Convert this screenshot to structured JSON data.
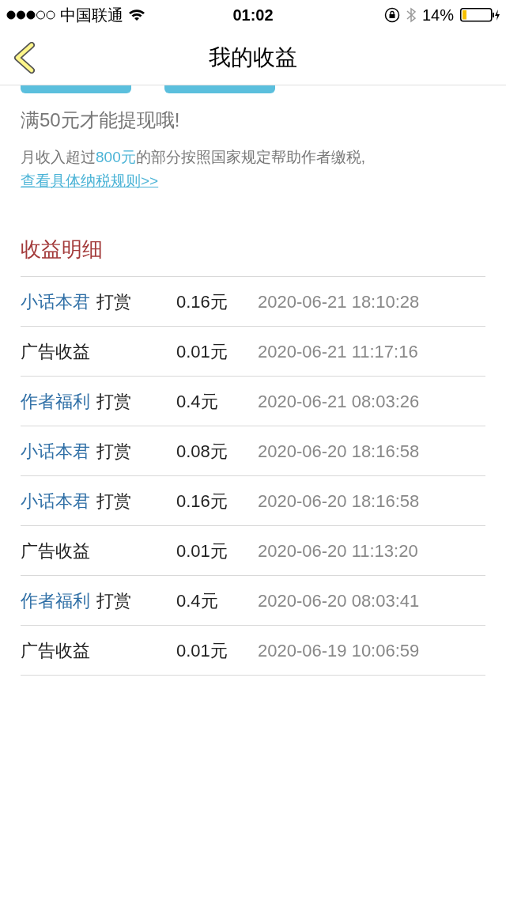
{
  "status_bar": {
    "carrier": "中国联通",
    "time": "01:02",
    "battery": "14%"
  },
  "nav": {
    "title": "我的收益"
  },
  "cut_buttons": [
    {
      "kind": "button"
    },
    {
      "kind": "button"
    }
  ],
  "notice": "满50元才能提现哦!",
  "tax_note": {
    "before": "月收入超过",
    "highlight": "800元",
    "after": "的部分按照国家规定帮助作者缴税,",
    "link": "查看具体纳税规则>>"
  },
  "section_title": "收益明细",
  "rows": [
    {
      "kind": "reward",
      "source": "小话本君",
      "type": "打赏",
      "amount": "0.16元",
      "time": "2020-06-21 18:10:28"
    },
    {
      "kind": "ad",
      "source": "广告收益",
      "amount": "0.01元",
      "time": "2020-06-21 11:17:16"
    },
    {
      "kind": "reward",
      "source": "作者福利",
      "type": "打赏",
      "amount": "0.4元",
      "time": "2020-06-21 08:03:26"
    },
    {
      "kind": "reward",
      "source": "小话本君",
      "type": "打赏",
      "amount": "0.08元",
      "time": "2020-06-20 18:16:58"
    },
    {
      "kind": "reward",
      "source": "小话本君",
      "type": "打赏",
      "amount": "0.16元",
      "time": "2020-06-20 18:16:58"
    },
    {
      "kind": "ad",
      "source": "广告收益",
      "amount": "0.01元",
      "time": "2020-06-20 11:13:20"
    },
    {
      "kind": "reward",
      "source": "作者福利",
      "type": "打赏",
      "amount": "0.4元",
      "time": "2020-06-20 08:03:41"
    },
    {
      "kind": "ad",
      "source": "广告收益",
      "amount": "0.01元",
      "time": "2020-06-19 10:06:59"
    }
  ]
}
